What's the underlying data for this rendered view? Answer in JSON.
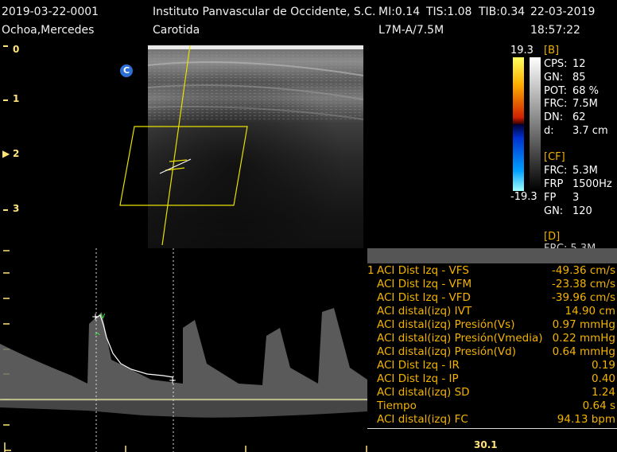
{
  "header": {
    "study_id": "2019-03-22-0001",
    "institution": "Instituto Panvascular de Occidente, S.C.",
    "mi": "MI:0.14",
    "tis": "TIS:1.08",
    "tib": "TIB:0.34",
    "date": "22-03-2019",
    "patient": "Ochoa,Mercedes",
    "exam": "Carotida",
    "probe": "L7M-A/7.5M",
    "time": "18:57:22"
  },
  "depth_scale": [
    "0",
    "1",
    "2",
    "3"
  ],
  "image_marker": "C",
  "colorbar": {
    "top": "19.3",
    "bottom": "-19.3"
  },
  "b_section": {
    "title": "[B]",
    "params": [
      {
        "key": "CPS:",
        "value": "12"
      },
      {
        "key": "GN:",
        "value": "85"
      },
      {
        "key": "POT:",
        "value": "68 %"
      },
      {
        "key": "FRC:",
        "value": "7.5M"
      },
      {
        "key": "DN:",
        "value": "62"
      },
      {
        "key": "d:",
        "value": "3.7 cm"
      }
    ]
  },
  "cf_section": {
    "title": "[CF]",
    "params": [
      {
        "key": "FRC:",
        "value": "5.3M"
      },
      {
        "key": "FRP",
        "value": "1500Hz"
      },
      {
        "key": "FP",
        "value": "3"
      },
      {
        "key": "GN:",
        "value": "120"
      }
    ]
  },
  "d_section": {
    "title": "[D]",
    "partial": "FRC: 5.3M"
  },
  "measurements": {
    "index": "1",
    "rows": [
      {
        "label": "ACI Dist Izq - VFS",
        "value": "-49.36 cm/s"
      },
      {
        "label": "ACI Dist Izq - VFM",
        "value": "-23.38 cm/s"
      },
      {
        "label": "ACI Dist Izq - VFD",
        "value": "-39.96 cm/s"
      },
      {
        "label": "ACI distal(izq) IVT",
        "value": "14.90 cm"
      },
      {
        "label": "ACI distal(izq) Presión(Vs)",
        "value": "0.97 mmHg"
      },
      {
        "label": "ACI distal(izq) Presión(Vmedia)",
        "value": "0.22 mmHg"
      },
      {
        "label": "ACI distal(izq) Presión(Vd)",
        "value": "0.64 mmHg"
      },
      {
        "label": "ACI Dist Izq - IR",
        "value": "0.19"
      },
      {
        "label": "ACI Dist Izq - IP",
        "value": "0.40"
      },
      {
        "label": "ACI distal(izq) SD",
        "value": "1.24"
      },
      {
        "label": "Tiempo",
        "value": "0.64 s"
      },
      {
        "label": "ACI distal(izq) FC",
        "value": "94.13 bpm"
      }
    ]
  },
  "bottom_readout": "30.1"
}
